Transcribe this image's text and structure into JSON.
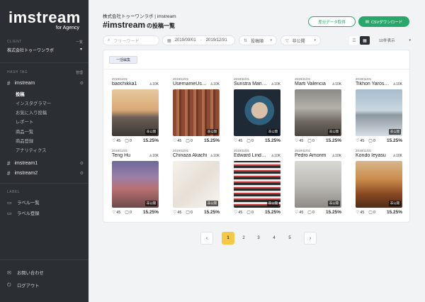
{
  "sidebar": {
    "logo": "imstream",
    "logo_sub": "for Agency",
    "client_label": "CLIENT",
    "client_link": "一覧",
    "client_name": "株式会社トゥーワンラボ",
    "hashtag_label": "HASH TAG",
    "hashtag_link": "管理",
    "hashtags": [
      {
        "name": "imstream",
        "subitems": [
          "投稿",
          "インスタグラマー",
          "お気に入り投稿",
          "レポート",
          "商品一覧",
          "商品登録",
          "アナリティクス"
        ],
        "active_sub": "投稿"
      },
      {
        "name": "imstream1"
      },
      {
        "name": "imstream2"
      }
    ],
    "label_label": "LABEL",
    "label_links": [
      "ラベル一覧",
      "ラベル登録"
    ],
    "bottom_links": [
      "お問い合わせ",
      "ログアウト"
    ]
  },
  "header": {
    "company": "株式会社トゥーワンラボ | imstream",
    "title": "#imstream",
    "title_suffix": "の投稿一覧",
    "diff_button": "差分データ取得",
    "csv_button": "CSVダウンロード"
  },
  "filters": {
    "keyword_placeholder": "フリーワード",
    "date_from": "2019/09/01",
    "date_sep": "-",
    "date_to": "2019/12/31",
    "sort": "投稿順",
    "visibility": "非公開",
    "per_page": "10件表示"
  },
  "bulk_edit": "一括編集",
  "posts": [
    {
      "date": "2019/11/01",
      "name": "baochikka1",
      "followers": "10K",
      "likes": "45",
      "comments": "0",
      "rate": "15.25%",
      "badge": "非公開"
    },
    {
      "date": "2019/11/01",
      "name": "UsernameUs…",
      "followers": "10K",
      "likes": "45",
      "comments": "0",
      "rate": "15.25%",
      "badge": "非公開"
    },
    {
      "date": "2019/11/01",
      "name": "Sunstra Man…",
      "followers": "10K",
      "likes": "45",
      "comments": "0",
      "rate": "15.25%",
      "badge": "非公開"
    },
    {
      "date": "2019/11/01",
      "name": "Marti Valencia",
      "followers": "10K",
      "likes": "45",
      "comments": "0",
      "rate": "15.25%",
      "badge": "非公開"
    },
    {
      "date": "2019/11/01",
      "name": "Tikhon Yaros…",
      "followers": "10K",
      "likes": "45",
      "comments": "0",
      "rate": "15.25%",
      "badge": "非公開"
    },
    {
      "date": "2019/11/01",
      "name": "Teng Hu",
      "followers": "10K",
      "likes": "45",
      "comments": "0",
      "rate": "15.25%",
      "badge": "非公開"
    },
    {
      "date": "2019/11/01",
      "name": "Chinaza Akachi",
      "followers": "10K",
      "likes": "45",
      "comments": "0",
      "rate": "15.25%",
      "badge": "非公開"
    },
    {
      "date": "2019/11/01",
      "name": "Edward Lind…",
      "followers": "10K",
      "likes": "45",
      "comments": "0",
      "rate": "15.25%",
      "badge": "非公開"
    },
    {
      "date": "2019/11/01",
      "name": "Pedro Amorim",
      "followers": "10K",
      "likes": "45",
      "comments": "0",
      "rate": "15.25%",
      "badge": "非公開"
    },
    {
      "date": "2019/11/01",
      "name": "Kondo Ieyasu",
      "followers": "10K",
      "likes": "45",
      "comments": "0",
      "rate": "15.25%",
      "badge": "非公開"
    }
  ],
  "pagination": {
    "prev": "‹",
    "pages": [
      "1",
      "2",
      "3",
      "4",
      "5"
    ],
    "current": "1",
    "next": "›"
  }
}
